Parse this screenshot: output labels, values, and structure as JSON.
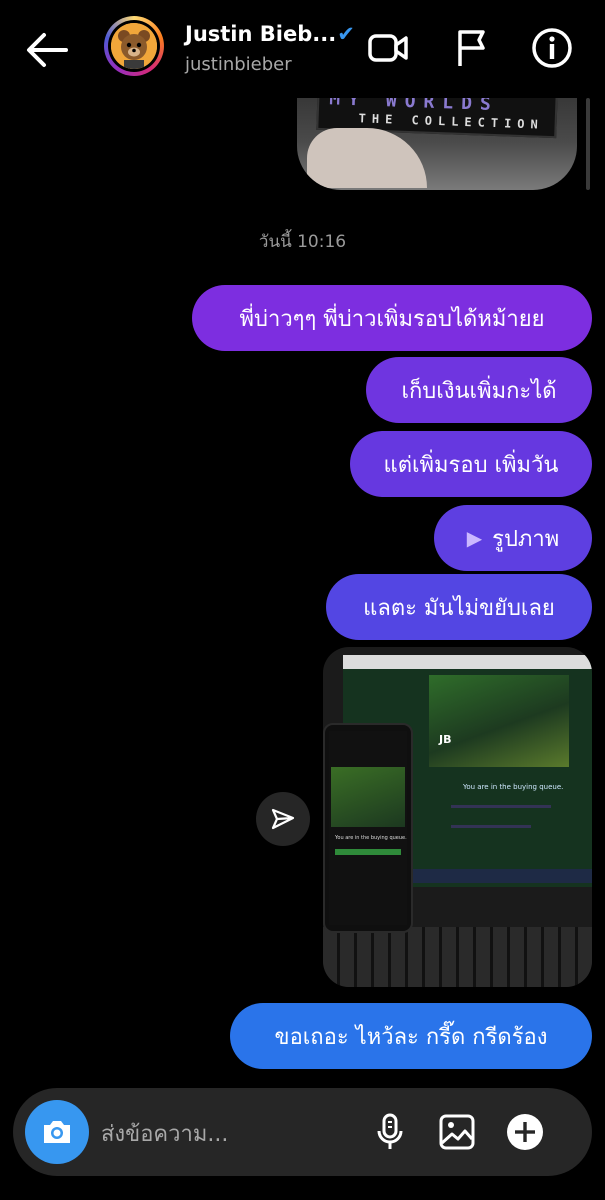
{
  "header": {
    "contact_name": "Justin Bieb...",
    "verified_glyph": "✔",
    "username": "justinbieber",
    "icons": [
      "back-arrow-icon",
      "video-call-icon",
      "flag-icon",
      "info-icon"
    ]
  },
  "chat": {
    "top_photo": {
      "text_line_1": "MY WORLDS",
      "text_line_2": "THE COLLECTION"
    },
    "timestamp": "วันนี้ 10:16",
    "messages": [
      {
        "text": "พี่บ่าวๆๆ พี่บ่าวเพิ่มรอบได้หม้ายย"
      },
      {
        "text": "เก็บเงินเพิ่มกะได้"
      },
      {
        "text": "แต่เพิ่มรอบ เพิ่มวัน"
      },
      {
        "text": "รูปภาพ",
        "play_glyph": "▶"
      },
      {
        "text": "แลตะ มันไม่ขยับเลย"
      },
      {
        "text": "ขอเถอะ ไหว้ละ กรี๊ด กรีดร้อง"
      }
    ],
    "photo": {
      "monitor_title": "JB",
      "monitor_queue_text": "You are in the buying queue.",
      "phone_queue_text": "You are in the buying queue."
    }
  },
  "composer": {
    "placeholder": "ส่งข้อความ...",
    "icons": [
      "camera-icon",
      "microphone-icon",
      "gallery-icon",
      "plus-icon"
    ]
  },
  "colors": {
    "gradient_top": "#7d2ee0",
    "gradient_mid": "#5346e3",
    "last_bubble": "#2a74ea",
    "camera_button": "#3797f0",
    "composer_bg": "#262626"
  }
}
